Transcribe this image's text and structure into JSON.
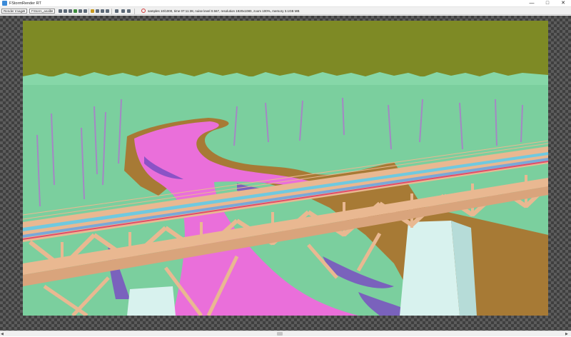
{
  "window": {
    "title": "FStormRender RT"
  },
  "toolbar": {
    "mode_select": {
      "value": "Render Image"
    },
    "camera_select": {
      "value": "FStorm_analb"
    },
    "status": "samples 10/1000,  time 07:11:38,  noise level 0.567,  resolution 1920x1080,  zoom 100%,  memory 3.1GB MB"
  },
  "icons": {
    "tools": [
      "save-icon",
      "copy-icon",
      "open-icon",
      "refresh-icon",
      "settings-icon",
      "region-icon",
      "pause-icon",
      "fit-icon",
      "zoom-icon",
      "lock-icon",
      "layers-icon",
      "histogram-icon",
      "info-icon"
    ],
    "status_color": "#d23a3a"
  },
  "colors": {
    "sky": "#7e8a25",
    "foliage": "#7bcf9e",
    "river": "#ea6fda",
    "bridge": "#e9b891",
    "ground": "#a77a35",
    "pillar": "#d8f2ee",
    "rail_blue": "#6fc9e0"
  }
}
